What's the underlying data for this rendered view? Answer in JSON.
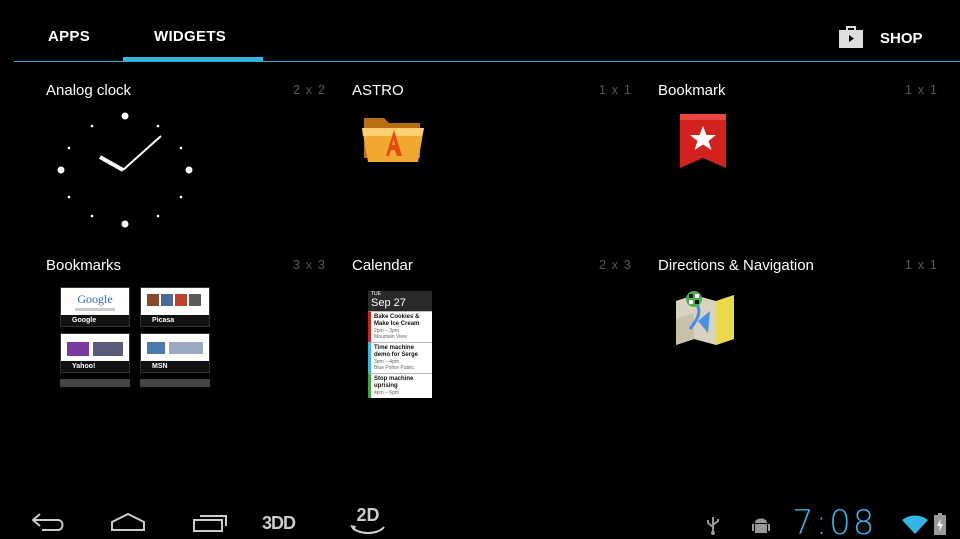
{
  "tabs": {
    "apps_label": "APPS",
    "widgets_label": "WIDGETS",
    "active": "WIDGETS",
    "shop_label": "SHOP",
    "shop_icon": "shopping-bag-icon",
    "accent_color": "#33b5e5"
  },
  "widgets": [
    {
      "name": "Analog clock",
      "size": "2 x 2"
    },
    {
      "name": "ASTRO",
      "size": "1 x 1"
    },
    {
      "name": "Bookmark",
      "size": "1 x 1"
    },
    {
      "name": "Bookmarks",
      "size": "3 x 3"
    },
    {
      "name": "Calendar",
      "size": "2 x 3"
    },
    {
      "name": "Directions & Navigation",
      "size": "1 x 1"
    }
  ],
  "bookmarks_preview": {
    "sites": [
      "Google",
      "Picasa",
      "Yahoo!",
      "MSN"
    ],
    "google_logo": "Google"
  },
  "calendar_preview": {
    "day_of_week": "TUE",
    "date": "Sep 27",
    "events": [
      {
        "title": "Bake Cookies & Make Ice Cream",
        "time": "2pm – 3pm",
        "place": "Mountain View"
      },
      {
        "title": "Time machine demo for Serge",
        "time": "3pm – 4pm",
        "place": "Blue Police Public"
      },
      {
        "title": "Stop machine uprising",
        "time": "4pm – 6pm",
        "place": ""
      }
    ]
  },
  "navbar": {
    "buttons": [
      "back-icon",
      "home-icon",
      "recent-apps-icon",
      "3dd-icon",
      "2d-icon"
    ],
    "label_3d": "3DD",
    "label_2d": "2D",
    "status_icons": [
      "usb-icon",
      "android-debug-icon",
      "wifi-icon",
      "battery-icon"
    ],
    "time": "7:08"
  }
}
